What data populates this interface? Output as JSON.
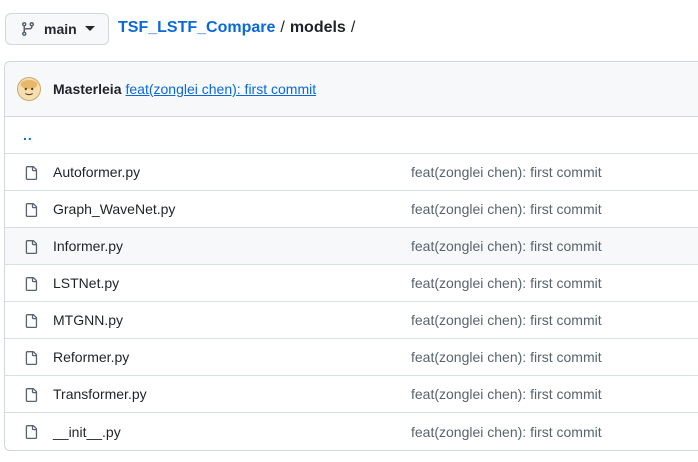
{
  "topbar": {
    "branch": "main",
    "repo": "TSF_LSTF_Compare",
    "separator": "/",
    "directory": "models",
    "trailing_separator": "/"
  },
  "latest_commit": {
    "author": "Masterleia",
    "message": "feat(zonglei chen): first commit"
  },
  "parent_dir_label": "..",
  "files": [
    {
      "name": "Autoformer.py",
      "commit": "feat(zonglei chen): first commit"
    },
    {
      "name": "Graph_WaveNet.py",
      "commit": "feat(zonglei chen): first commit"
    },
    {
      "name": "Informer.py",
      "commit": "feat(zonglei chen): first commit"
    },
    {
      "name": "LSTNet.py",
      "commit": "feat(zonglei chen): first commit"
    },
    {
      "name": "MTGNN.py",
      "commit": "feat(zonglei chen): first commit"
    },
    {
      "name": "Reformer.py",
      "commit": "feat(zonglei chen): first commit"
    },
    {
      "name": "Transformer.py",
      "commit": "feat(zonglei chen): first commit"
    },
    {
      "name": "__init__.py",
      "commit": "feat(zonglei chen): first commit"
    }
  ],
  "colors": {
    "link": "#0969da",
    "muted": "#59636e",
    "border": "#d0d7de",
    "header_bg": "#f6f8fa"
  },
  "icons": {
    "branch": "git-branch-icon",
    "caret": "caret-down-icon",
    "file": "file-icon",
    "avatar": "avatar"
  }
}
